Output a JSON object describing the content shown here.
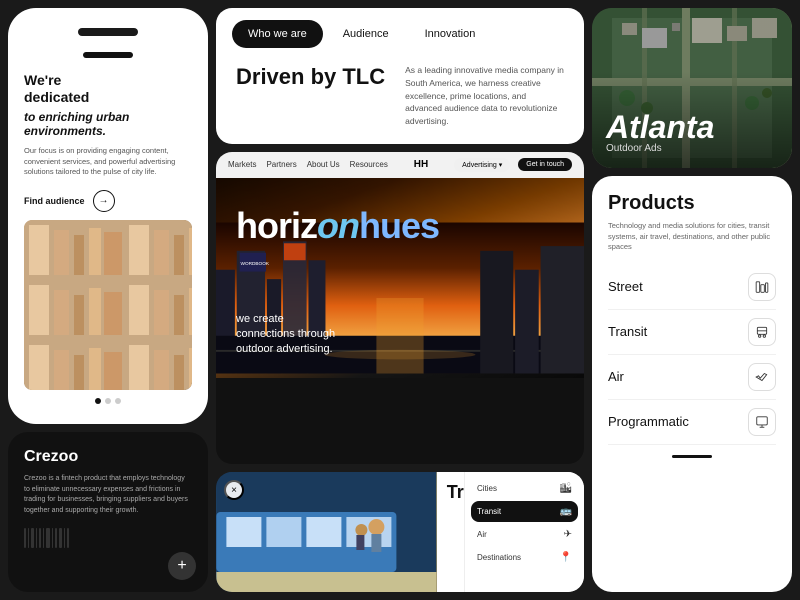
{
  "phone_top": {
    "headline_1": "We're",
    "headline_2": "dedicated",
    "headline_italic": "to enriching urban environments.",
    "sub": "Our focus is on providing engaging content, convenient services, and powerful advertising solutions tailored to the pulse of city life.",
    "find_btn": "Find audience"
  },
  "crezoo": {
    "brand": "Crezoo",
    "desc": "Crezoo is a fintech product that employs technology to eliminate unnecessary expenses and frictions in trading for businesses, bringing suppliers and buyers together and supporting their growth.",
    "add_icon": "+"
  },
  "tabs": {
    "items": [
      {
        "label": "Who we are",
        "active": true
      },
      {
        "label": "Audience",
        "active": false
      },
      {
        "label": "Innovation",
        "active": false
      }
    ],
    "driven_title": "Driven by TLC",
    "driven_desc": "As a leading innovative media company in South America, we harness creative excellence, prime locations, and advanced audience data to revolutionize advertising."
  },
  "hero": {
    "title_horiz": "horiz",
    "title_on": "on",
    "title_hues": "hues",
    "subtitle_line1": "we create",
    "subtitle_line2": "connections through",
    "subtitle_line3": "outdoor advertising.",
    "nav": {
      "markets": "Markets",
      "partners": "Partners",
      "about": "About Us",
      "resources": "Resources",
      "logo": "HH",
      "advertising": "Advertising",
      "get_in_touch": "Get in touch"
    }
  },
  "transit": {
    "close": "×",
    "transform_title": "Transform",
    "panel_items": [
      {
        "label": "Cities",
        "icon": "🏙",
        "selected": false
      },
      {
        "label": "Transit",
        "icon": "🚌",
        "selected": true
      },
      {
        "label": "Air",
        "icon": "✈",
        "selected": false
      },
      {
        "label": "Destinations",
        "icon": "📍",
        "selected": false
      }
    ]
  },
  "atlanta": {
    "city_name": "Atlanta",
    "subtitle": "Outdoor Ads"
  },
  "products": {
    "title": "Products",
    "desc": "Technology and media solutions for cities, transit systems, air travel, destinations, and other public spaces",
    "items": [
      {
        "name": "Street",
        "icon": "🏙"
      },
      {
        "name": "Transit",
        "icon": "🚌"
      },
      {
        "name": "Air",
        "icon": "✈"
      },
      {
        "name": "Programmatic",
        "icon": "💻"
      }
    ]
  }
}
